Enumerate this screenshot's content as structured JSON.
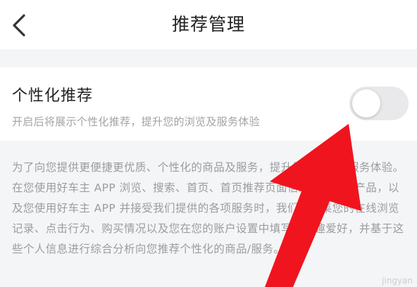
{
  "header": {
    "title": "推荐管理",
    "back_icon": "chevron-left-icon"
  },
  "setting": {
    "title": "个性化推荐",
    "description": "开启后将展示个性化推荐，提升您的浏览及服务体验",
    "toggle_on": false
  },
  "explanation": {
    "text": "为了向您提供更便捷更优质、个性化的商品及服务，提升您的浏览及服务体验。在您使用好车主 APP 浏览、搜索、首页、首页推荐页面信息购买保险产品，以及您使用好车主 APP 并接受我们提供的各项服务时，我们将收集您的在线浏览记录、点击行为、购买情况以及您在您的账户设置中填写的兴趣爱好，并基于这些个人信息进行综合分析向您推荐个性化的商品/服务。"
  },
  "overlay": {
    "arrow_color": "#f0141e"
  }
}
